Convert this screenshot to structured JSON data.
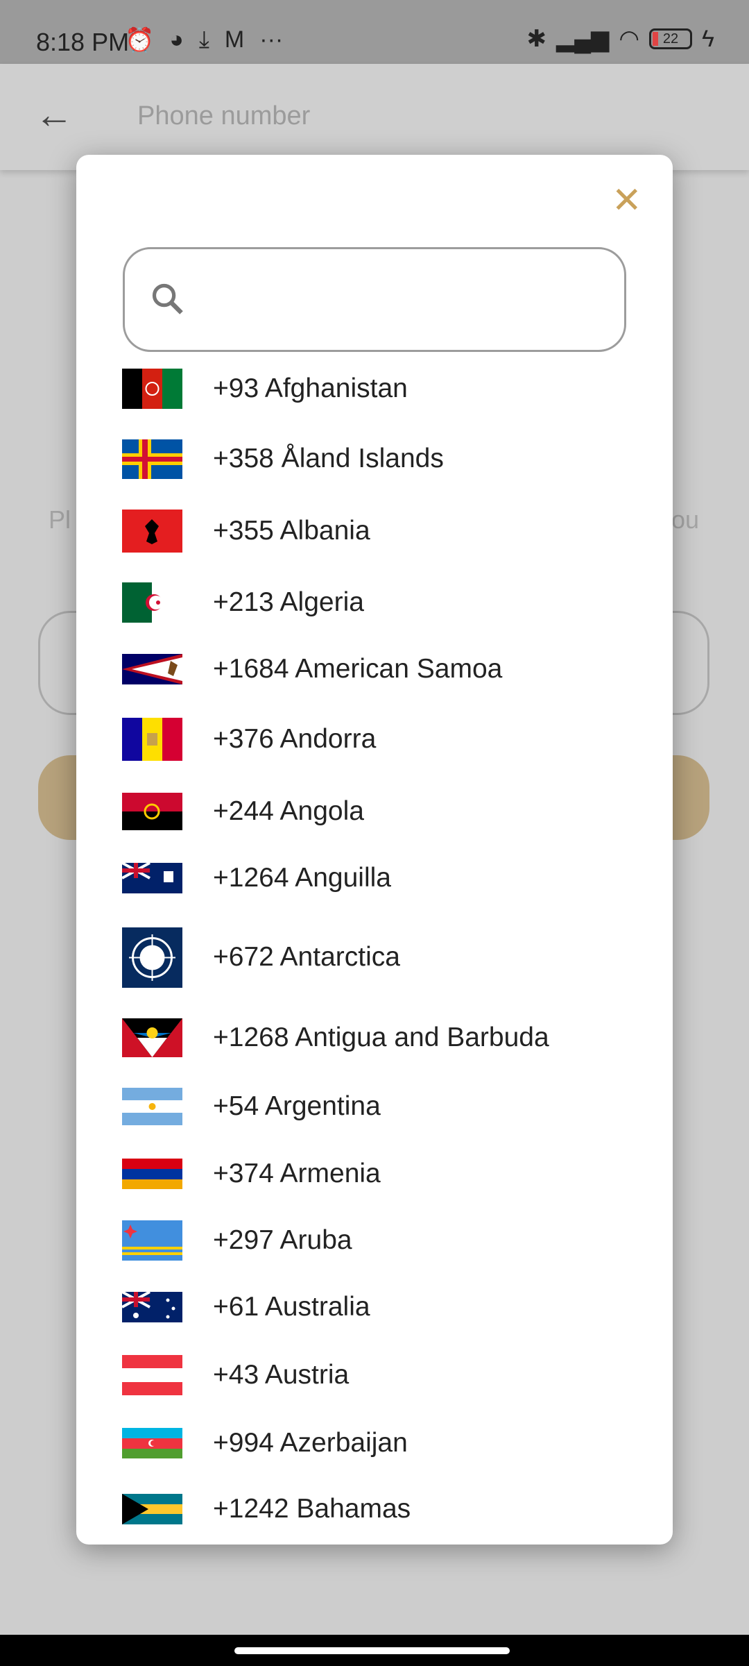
{
  "status_bar": {
    "time": "8:18 PM",
    "battery": "22",
    "icons": [
      "alarm-icon",
      "discord-icon",
      "download-icon",
      "gmail-icon",
      "more-icon",
      "bluetooth-icon",
      "signal-icon",
      "wifi-icon",
      "battery-icon",
      "charging-icon"
    ]
  },
  "app_bar": {
    "title": "Phone number"
  },
  "background": {
    "text_left": "Pl",
    "text_right": "ou"
  },
  "dialog": {
    "close_icon": "close-icon",
    "search_icon": "search-icon",
    "search_value": "",
    "accent": "#c9a15a",
    "countries": [
      {
        "code": "+93",
        "name": "Afghanistan"
      },
      {
        "code": "+358",
        "name": "Åland Islands"
      },
      {
        "code": "+355",
        "name": "Albania"
      },
      {
        "code": "+213",
        "name": "Algeria"
      },
      {
        "code": "+1684",
        "name": "American Samoa"
      },
      {
        "code": "+376",
        "name": "Andorra"
      },
      {
        "code": "+244",
        "name": "Angola"
      },
      {
        "code": "+1264",
        "name": "Anguilla"
      },
      {
        "code": "+672",
        "name": "Antarctica"
      },
      {
        "code": "+1268",
        "name": "Antigua and Barbuda"
      },
      {
        "code": "+54",
        "name": "Argentina"
      },
      {
        "code": "+374",
        "name": "Armenia"
      },
      {
        "code": "+297",
        "name": "Aruba"
      },
      {
        "code": "+61",
        "name": "Australia"
      },
      {
        "code": "+43",
        "name": "Austria"
      },
      {
        "code": "+994",
        "name": "Azerbaijan"
      },
      {
        "code": "+1242",
        "name": "Bahamas"
      }
    ]
  }
}
